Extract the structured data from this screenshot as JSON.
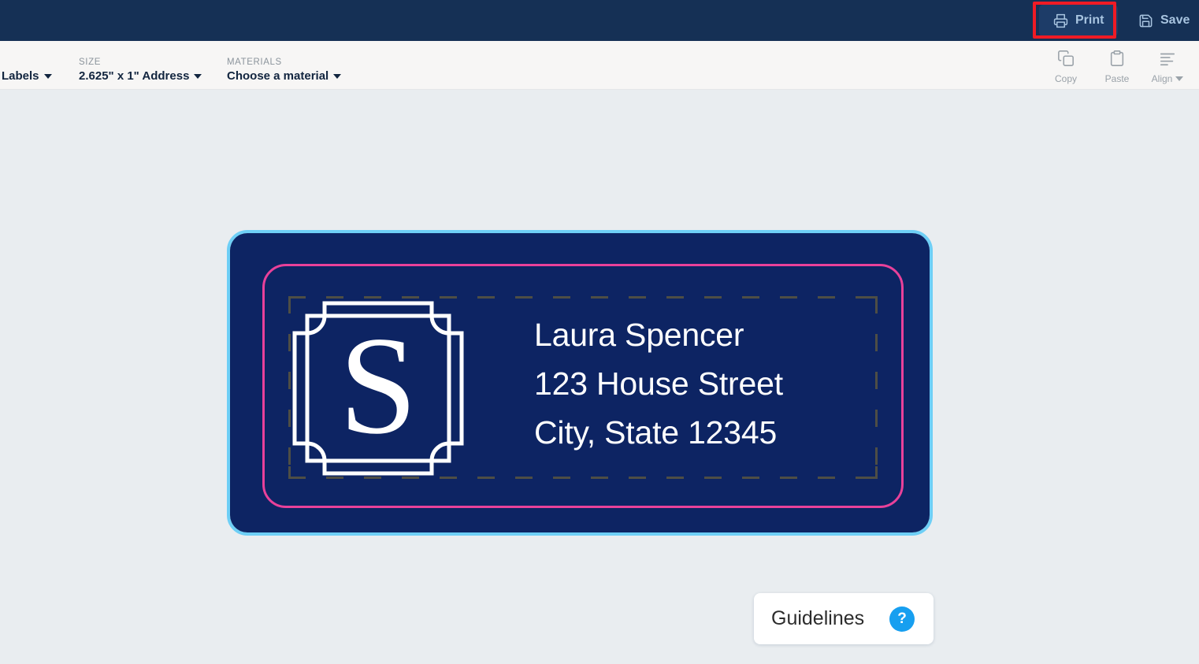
{
  "top_nav": {
    "background": "#153055",
    "print": {
      "label": "Print",
      "icon": "printer-icon",
      "highlighted": true
    },
    "save": {
      "label": "Save",
      "icon": "floppy-disk-icon"
    },
    "highlight_color": "#f01b25"
  },
  "toolbar": {
    "product": {
      "label": "Labels",
      "caret": "chevron-down-icon"
    },
    "size": {
      "heading": "SIZE",
      "value": "2.625\" x 1\" Address",
      "caret": "chevron-down-icon"
    },
    "materials": {
      "heading": "MATERIALS",
      "value": "Choose a material",
      "caret": "chevron-down-icon"
    },
    "copy": {
      "label": "Copy",
      "icon": "copy-icon"
    },
    "paste": {
      "label": "Paste",
      "icon": "paste-icon"
    },
    "align": {
      "label": "Align",
      "icon": "align-left-icon",
      "caret": "chevron-down-icon"
    }
  },
  "canvas": {
    "background": "#e9edf0"
  },
  "label": {
    "selected": true,
    "selection_color": "#6ecff6",
    "artboard_color": "#0d2463",
    "accent_border_color": "#e8419a",
    "guide_color": "#4e4e45",
    "monogram": {
      "letter": "S",
      "frame": "ornate-square-frame"
    },
    "address": {
      "line1": "Laura Spencer",
      "line2": "123 House Street",
      "line3": "City, State 12345",
      "text_color": "#ffffff"
    }
  },
  "guidelines": {
    "label": "Guidelines",
    "help_glyph": "?",
    "help_color": "#179ff0"
  }
}
